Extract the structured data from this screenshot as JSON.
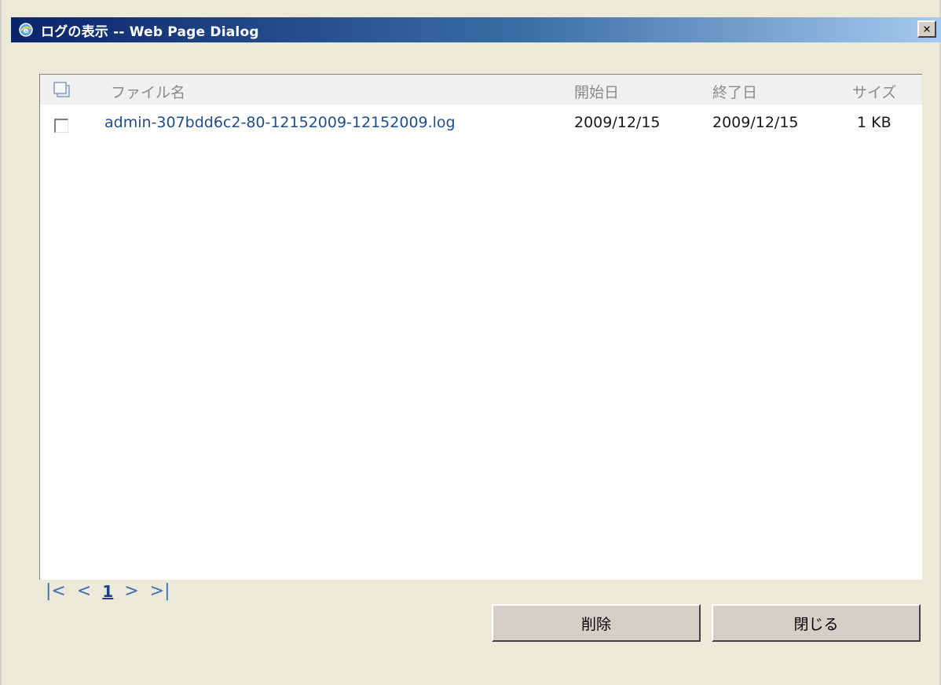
{
  "window": {
    "title": "ログの表示 -- Web Page Dialog",
    "icon": "ie-icon",
    "close_label": "×"
  },
  "table": {
    "columns": {
      "select_all_icon": "select-all-icon",
      "filename": "ファイル名",
      "start_date": "開始日",
      "end_date": "終了日",
      "size": "サイズ"
    },
    "rows": [
      {
        "checked": false,
        "filename": "admin-307bdd6c2-80-12152009-12152009.log",
        "start_date": "2009/12/15",
        "end_date": "2009/12/15",
        "size": "1 KB"
      }
    ]
  },
  "pager": {
    "first": "|<",
    "prev": "<",
    "current_page": "1",
    "next": ">",
    "last": ">|"
  },
  "buttons": {
    "delete": "削除",
    "close": "閉じる"
  },
  "colors": {
    "titlebar_start": "#0a246a",
    "titlebar_end": "#a6caf0",
    "link": "#1f4e8c",
    "pager": "#3b6fb6",
    "dialog_bg": "#ece9d8"
  }
}
